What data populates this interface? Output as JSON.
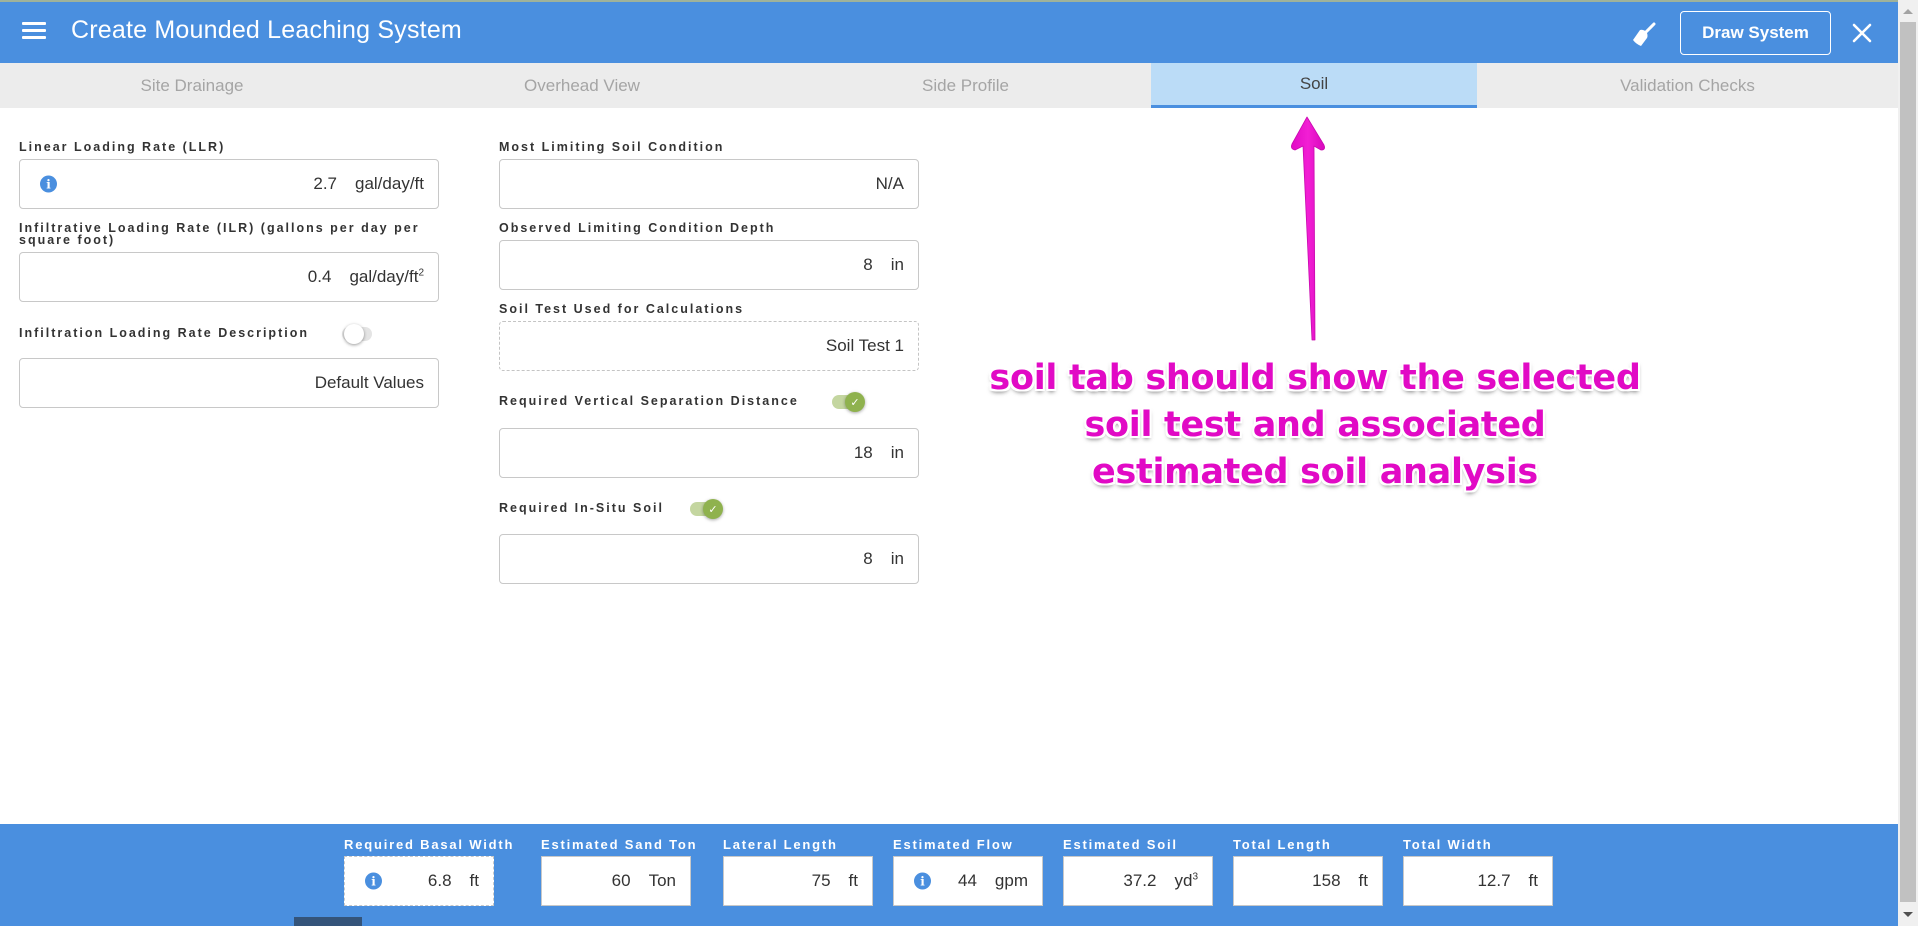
{
  "header": {
    "title": "Create Mounded Leaching System",
    "menu_icon": "hamburger-menu-icon",
    "clear_icon": "broom-icon",
    "draw_button_label": "Draw System",
    "close_icon": "close-icon"
  },
  "tabs": [
    {
      "label": "Site Drainage",
      "active": false
    },
    {
      "label": "Overhead View",
      "active": false
    },
    {
      "label": "Side Profile",
      "active": false
    },
    {
      "label": "Soil",
      "active": true
    },
    {
      "label": "Validation Checks",
      "active": false
    }
  ],
  "form": {
    "llr": {
      "label": "Linear Loading Rate (LLR)",
      "value": "2.7",
      "unit": "gal/day/ft",
      "icon": "info-icon"
    },
    "ilr": {
      "label": "Infiltrative Loading Rate (ILR) (gallons per day per square foot)",
      "value": "0.4",
      "unit": "gal/day/ft",
      "unit_sup": "2"
    },
    "ilr_description": {
      "label": "Infiltration Loading Rate Description",
      "toggle_on": false,
      "value": "Default Values"
    },
    "limiting_condition": {
      "label": "Most Limiting Soil Condition",
      "value": "N/A"
    },
    "limiting_depth": {
      "label": "Observed Limiting Condition Depth",
      "value": "8",
      "unit": "in"
    },
    "soil_test": {
      "label": "Soil Test Used for Calculations",
      "value": "Soil Test 1"
    },
    "vertical_separation": {
      "label": "Required Vertical Separation Distance",
      "toggle_on": true,
      "value": "18",
      "unit": "in"
    },
    "in_situ_soil": {
      "label": "Required In-Situ Soil",
      "toggle_on": true,
      "value": "8",
      "unit": "in"
    }
  },
  "annotation": {
    "text": "soil tab should show the selected soil test and associated estimated soil analysis",
    "color": "#e10ac5"
  },
  "summary": [
    {
      "label": "Required Basal Width",
      "value": "6.8",
      "unit": "ft",
      "info": true
    },
    {
      "label": "Estimated Sand Ton",
      "value": "60",
      "unit": "Ton"
    },
    {
      "label": "Lateral Length",
      "value": "75",
      "unit": "ft"
    },
    {
      "label": "Estimated Flow",
      "value": "44",
      "unit": "gpm",
      "info": true
    },
    {
      "label": "Estimated Soil",
      "value": "37.2",
      "unit": "yd",
      "unit_sup": "3"
    },
    {
      "label": "Total Length",
      "value": "158",
      "unit": "ft"
    },
    {
      "label": "Total Width",
      "value": "12.7",
      "unit": "ft"
    }
  ],
  "colors": {
    "primary": "#4a8fdf",
    "active_tab": "#bbdcf7",
    "toggle_on": "#8fb24e"
  }
}
